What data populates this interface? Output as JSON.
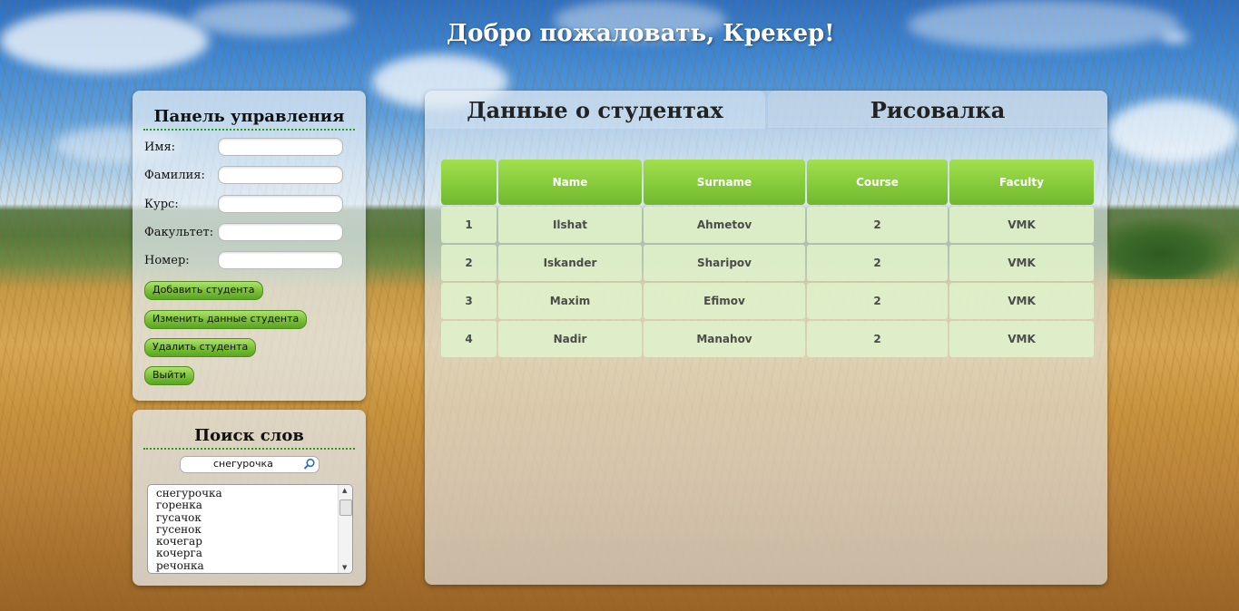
{
  "header": {
    "welcome": "Добро пожаловать, Крекер!"
  },
  "control_panel": {
    "title": "Панель управления",
    "fields": [
      {
        "label": "Имя:",
        "value": ""
      },
      {
        "label": "Фамилия:",
        "value": ""
      },
      {
        "label": "Курс:",
        "value": ""
      },
      {
        "label": "Факультет:",
        "value": ""
      },
      {
        "label": "Номер:",
        "value": ""
      }
    ],
    "buttons": {
      "add": "Добавить студента",
      "edit": "Изменить данные студента",
      "delete": "Удалить студента",
      "logout": "Выйти"
    }
  },
  "search_panel": {
    "title": "Поиск слов",
    "query": "снегурочка",
    "results": [
      "снегурочка",
      "горенка",
      "гусачок",
      "гусенок",
      "кочегар",
      "кочерга",
      "речонка"
    ]
  },
  "tabs": [
    {
      "label": "Данные о студентах",
      "active": true
    },
    {
      "label": "Рисовалка",
      "active": false
    }
  ],
  "students_table": {
    "headers": [
      "",
      "Name",
      "Surname",
      "Course",
      "Faculty"
    ],
    "rows": [
      [
        "1",
        "Ilshat",
        "Ahmetov",
        "2",
        "VMK"
      ],
      [
        "2",
        "Iskander",
        "Sharipov",
        "2",
        "VMK"
      ],
      [
        "3",
        "Maxim",
        "Efimov",
        "2",
        "VMK"
      ],
      [
        "4",
        "Nadir",
        "Manahov",
        "2",
        "VMK"
      ]
    ]
  },
  "colors": {
    "button_green": "#7dc23b",
    "header_green": "#86cb3b",
    "row_bg": "#def0c9"
  }
}
